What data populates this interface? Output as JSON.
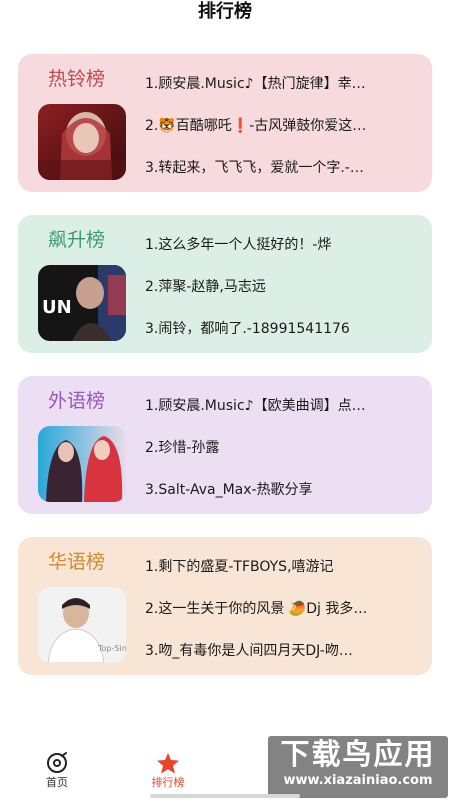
{
  "page": {
    "title": "排行榜"
  },
  "charts": [
    {
      "name": "热铃榜",
      "name_color": "#c24a52",
      "bg": "#f7dadd",
      "cover_icon": "cover-art-hooded-portrait",
      "tracks": [
        "1.顾安晨.Music♪【热门旋律】幸…",
        "2.🐯百酷哪吒❗-古风弹鼓你爱这…",
        "3.转起来，飞飞飞，爱就一个字.-…"
      ]
    },
    {
      "name": "飙升榜",
      "name_color": "#3e9a6e",
      "bg": "#dcefe6",
      "cover_icon": "cover-art-un-portrait",
      "tracks": [
        "1.这么多年一个人挺好的！-烨",
        "2.萍聚-赵静,马志远",
        "3.闹铃，都响了.-18991541176"
      ]
    },
    {
      "name": "外语榜",
      "name_color": "#9a56b8",
      "bg": "#ecdff4",
      "cover_icon": "cover-art-two-singers",
      "tracks": [
        "1.顾安晨.Music♪【欧美曲调】点…",
        "2.珍惜-孙露",
        "3.Salt-Ava_Max-热歌分享"
      ]
    },
    {
      "name": "华语榜",
      "name_color": "#d08a2e",
      "bg": "#f8e5d6",
      "cover_icon": "cover-art-top-singer",
      "tracks": [
        "1.剩下的盛夏-TFBOYS,嘻游记",
        "2.这一生关于你的风景 🥭Dj 我多…",
        "3.吻_有毒你是人间四月天DJ-吻…"
      ]
    }
  ],
  "tabbar": {
    "tabs": [
      {
        "label": "首页",
        "icon": "home-disc-icon",
        "active": false
      },
      {
        "label": "排行榜",
        "icon": "star-icon",
        "active": true
      }
    ],
    "active_color": "#e8452b"
  },
  "watermark": {
    "main": "下载鸟应用",
    "sub": "www.xiazainiao.com"
  }
}
